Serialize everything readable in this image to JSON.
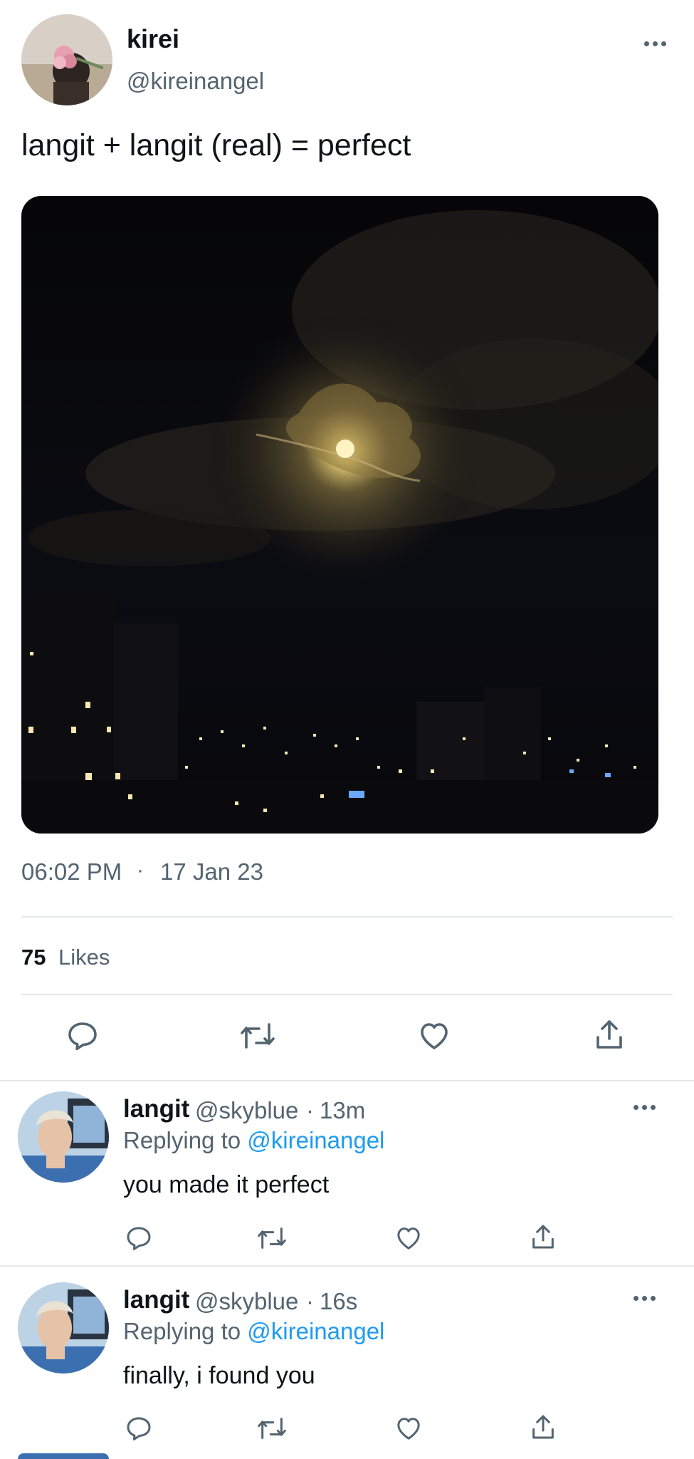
{
  "tweet": {
    "display_name": "kirei",
    "handle": "@kireinangel",
    "text": "langit + langit (real) = perfect",
    "time": "06:02 PM",
    "separator": "·",
    "date": "17 Jan 23",
    "likes_count": "75",
    "likes_label": "Likes"
  },
  "actions": {
    "icons": [
      "reply-icon",
      "retweet-icon",
      "like-icon",
      "share-icon"
    ]
  },
  "replies": [
    {
      "name": "langit",
      "handle": "@skyblue",
      "dot": "·",
      "time": "13m",
      "replying_prefix": "Replying to",
      "replying_handle": "@kireinangel",
      "text": "you made it perfect"
    },
    {
      "name": "langit",
      "handle": "@skyblue",
      "dot": "·",
      "time": "16s",
      "replying_prefix": "Replying to",
      "replying_handle": "@kireinangel",
      "text": "finally, i found you"
    }
  ],
  "colors": {
    "link": "#1d9bf0",
    "secondary_text": "#536471",
    "divider": "#e6e9eb"
  }
}
